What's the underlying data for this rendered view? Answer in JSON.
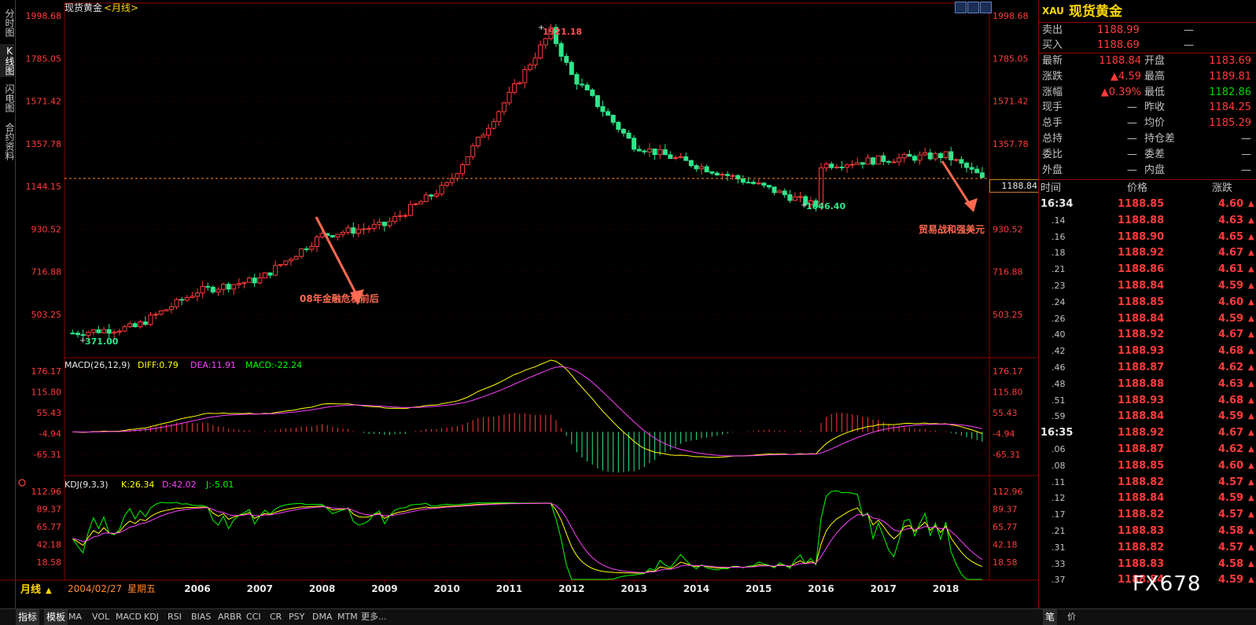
{
  "left_tabs": [
    {
      "label": "分时图"
    },
    {
      "label": "K线图"
    },
    {
      "label": "闪电图"
    },
    {
      "label": "合约资料"
    }
  ],
  "chart": {
    "title": "现货黄金",
    "period_tag": "<月线>",
    "price_axis_labels": [
      "1998.68",
      "1785.05",
      "1571.42",
      "1357.78",
      "1144.15",
      "930.52",
      "716.88",
      "503.25"
    ],
    "current_price": "1188.84",
    "high_label": "1921.18",
    "low_label": "371.00",
    "low2_label": "1046.40",
    "annotations": [
      "08年金融危机前后",
      "贸易战和强美元"
    ],
    "macd": {
      "name": "MACD(26,12,9)",
      "diff": "DIFF:0.79",
      "dea": "DEA:11.91",
      "macd": "MACD:-22.24",
      "axis": [
        "176.17",
        "115.80",
        "55.43",
        "-4.94",
        "-65.31"
      ]
    },
    "kdj": {
      "name": "KDJ(9,3,3)",
      "k": "K:26.34",
      "d": "D:42.02",
      "j": "J:-5.01",
      "axis": [
        "112.96",
        "89.37",
        "65.77",
        "42.18",
        "18.58"
      ]
    },
    "years": [
      "2006",
      "2007",
      "2008",
      "2009",
      "2010",
      "2011",
      "2012",
      "2013",
      "2014",
      "2015",
      "2016",
      "2017",
      "2018"
    ],
    "period_button": "月线",
    "cursor_date": "2004/02/27",
    "cursor_weekday": "星期五",
    "colors": {
      "up": "#ff3b3b",
      "down": "#2ee68a",
      "diff": "#ffff00",
      "dea": "#ff40ff",
      "k": "#ffff00",
      "d": "#ff40ff",
      "j": "#00ff00",
      "grid": "#8b0000"
    }
  },
  "chart_data": {
    "type": "candlestick",
    "title": "现货黄金",
    "x_ticks": [
      "2006",
      "2007",
      "2008",
      "2009",
      "2010",
      "2011",
      "2012",
      "2013",
      "2014",
      "2015",
      "2016",
      "2017",
      "2018"
    ],
    "y_ticks": [
      1998.68,
      1785.05,
      1571.42,
      1357.78,
      1144.15,
      930.52,
      716.88,
      503.25
    ],
    "series": [
      {
        "name": "现货黄金",
        "x": [
          "2004",
          "2005",
          "2006",
          "2007",
          "2008",
          "2009",
          "2010",
          "2011",
          "2011-09",
          "2012",
          "2013",
          "2014",
          "2015",
          "2015-12",
          "2016",
          "2017",
          "2018",
          "2018-08"
        ],
        "y": [
          410,
          440,
          620,
          680,
          900,
          950,
          1150,
          1600,
          1921.18,
          1700,
          1350,
          1250,
          1150,
          1046.4,
          1250,
          1280,
          1300,
          1188.84
        ]
      },
      {
        "name": "MACD",
        "values": {
          "DIFF": 0.79,
          "DEA": 11.91,
          "MACD": -22.24
        }
      },
      {
        "name": "KDJ",
        "values": {
          "K": 26.34,
          "D": 42.02,
          "J": -5.01
        }
      }
    ]
  },
  "quote": {
    "symbol": "XAU",
    "name": "现货黄金",
    "rows": [
      {
        "label": "卖出",
        "value": "1188.99",
        "extra": "—"
      },
      {
        "label": "买入",
        "value": "1188.69",
        "extra": "—"
      }
    ],
    "pairs": [
      {
        "l1": "最新",
        "v1": "1188.84",
        "l2": "开盘",
        "v2": "1183.69"
      },
      {
        "l1": "涨跌",
        "v1": "4.59",
        "l2": "最高",
        "v2": "1189.81"
      },
      {
        "l1": "涨幅",
        "v1": "0.39%",
        "l2": "最低",
        "v2": "1182.86"
      },
      {
        "l1": "现手",
        "v1": "—",
        "l2": "昨收",
        "v2": "1184.25"
      },
      {
        "l1": "总手",
        "v1": "—",
        "l2": "均价",
        "v2": "1185.29"
      },
      {
        "l1": "总持",
        "v1": "—",
        "l2": "持仓差",
        "v2": "—"
      },
      {
        "l1": "委比",
        "v1": "—",
        "l2": "委差",
        "v2": "—"
      },
      {
        "l1": "外盘",
        "v1": "—",
        "l2": "内盘",
        "v2": "—"
      }
    ]
  },
  "ticks": {
    "headers": {
      "time": "时间",
      "price": "价格",
      "change": "涨跌"
    },
    "rows": [
      {
        "time": "16:34",
        "price": "1188.85",
        "chg": "4.60"
      },
      {
        "time": ".14",
        "price": "1188.88",
        "chg": "4.63"
      },
      {
        "time": ".16",
        "price": "1188.90",
        "chg": "4.65"
      },
      {
        "time": ".18",
        "price": "1188.92",
        "chg": "4.67"
      },
      {
        "time": ".21",
        "price": "1188.86",
        "chg": "4.61"
      },
      {
        "time": ".23",
        "price": "1188.84",
        "chg": "4.59"
      },
      {
        "time": ".24",
        "price": "1188.85",
        "chg": "4.60"
      },
      {
        "time": ".26",
        "price": "1188.84",
        "chg": "4.59"
      },
      {
        "time": ".40",
        "price": "1188.92",
        "chg": "4.67"
      },
      {
        "time": ".42",
        "price": "1188.93",
        "chg": "4.68"
      },
      {
        "time": ".46",
        "price": "1188.87",
        "chg": "4.62"
      },
      {
        "time": ".48",
        "price": "1188.88",
        "chg": "4.63"
      },
      {
        "time": ".51",
        "price": "1188.93",
        "chg": "4.68"
      },
      {
        "time": ".59",
        "price": "1188.84",
        "chg": "4.59"
      },
      {
        "time": "16:35",
        "price": "1188.92",
        "chg": "4.67"
      },
      {
        "time": ".06",
        "price": "1188.87",
        "chg": "4.62"
      },
      {
        "time": ".08",
        "price": "1188.85",
        "chg": "4.60"
      },
      {
        "time": ".11",
        "price": "1188.82",
        "chg": "4.57"
      },
      {
        "time": ".12",
        "price": "1188.84",
        "chg": "4.59"
      },
      {
        "time": ".17",
        "price": "1188.82",
        "chg": "4.57"
      },
      {
        "time": ".21",
        "price": "1188.83",
        "chg": "4.58"
      },
      {
        "time": ".31",
        "price": "1188.82",
        "chg": "4.57"
      },
      {
        "time": ".33",
        "price": "1188.83",
        "chg": "4.58"
      },
      {
        "time": ".37",
        "price": "1188.84",
        "chg": "4.59"
      }
    ]
  },
  "bottom_tabs": [
    "指标",
    "模板",
    "MA",
    "VOL",
    "MACD",
    "KDJ",
    "RSI",
    "BIAS",
    "ARBR",
    "CCI",
    "CR",
    "PSY",
    "DMA",
    "MTM",
    "更多..."
  ],
  "right_bottom_tabs": [
    "笔",
    "价"
  ],
  "watermark": "FX678"
}
